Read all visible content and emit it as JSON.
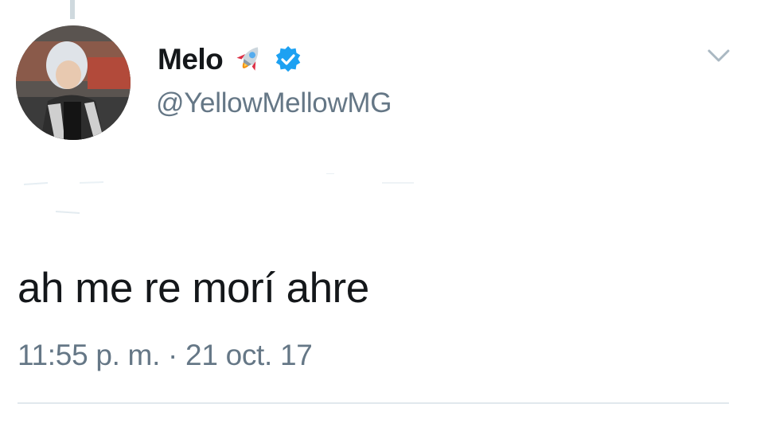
{
  "tweet": {
    "display_name": "Melo",
    "handle": "@YellowMellowMG",
    "name_emoji": "rocket-icon",
    "verified": true,
    "text": "ah me re morí ahre",
    "timestamp": "11:55 p. m. · 21 oct. 17"
  },
  "icons": {
    "more": "chevron-down-icon",
    "verified": "verified-badge-icon"
  },
  "colors": {
    "name": "#14171a",
    "secondary": "#657786",
    "verified_blue": "#1da1f2",
    "divider": "#e1e8ed"
  }
}
